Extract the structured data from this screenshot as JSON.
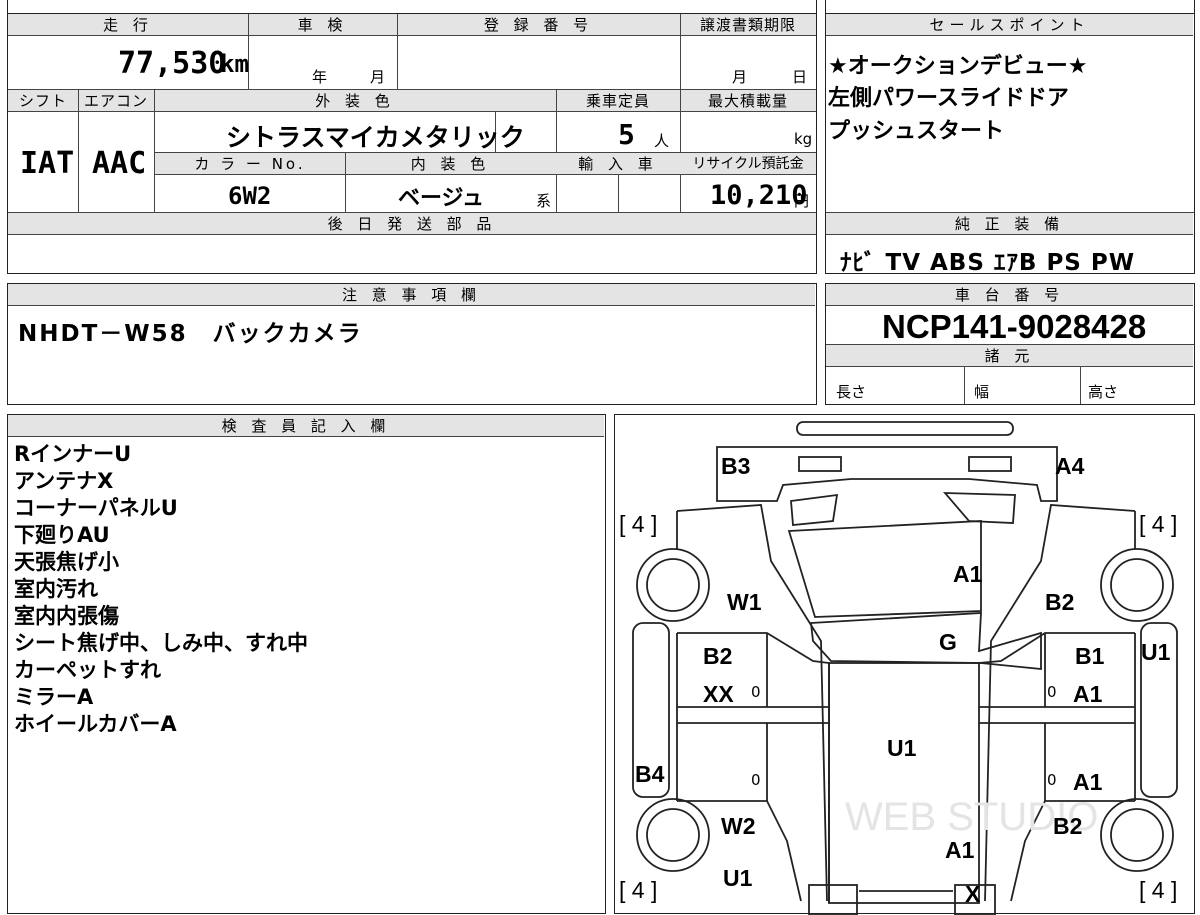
{
  "top_table": {
    "h_mileage": "走 行",
    "h_inspection": "車 検",
    "h_reg_number": "登 録 番 号",
    "h_transfer_deadline": "譲渡書類期限",
    "mileage": "77,530",
    "mileage_unit": "km",
    "insp_year": "年",
    "insp_month": "月",
    "tr_month": "月",
    "tr_day": "日",
    "h_shift": "シフト",
    "h_aircon": "エアコン",
    "h_ext_color": "外 装 色",
    "h_capacity": "乗車定員",
    "h_max_load": "最大積載量",
    "shift": "IAT",
    "aircon": "AAC",
    "ext_color": "シトラスマイカメタリック",
    "capacity": "5",
    "capacity_unit": "人",
    "load_unit": "kg",
    "h_color_no": "カ ラ ー No.",
    "h_int_color": "内 装 色",
    "h_import": "輸 入 車",
    "h_recycle": "リサイクル預託金",
    "color_no": "6W2",
    "int_color": "ベージュ",
    "int_color_suffix": "系",
    "recycle_fee": "10,210",
    "recycle_unit": "円",
    "h_later_parts": "後 日 発 送 部 品"
  },
  "sales_points": {
    "header": "セールスポイント",
    "lines": [
      "★オークションデビュー★",
      "左側パワースライドドア",
      "プッシュスタート"
    ]
  },
  "equipment": {
    "header": "純 正 装 備",
    "value": "ﾅﾋﾞ TV ABS ｴｱB PS PW"
  },
  "notes": {
    "header": "注 意 事 項 欄",
    "value": "NHDT－W58　バックカメラ"
  },
  "chassis": {
    "header": "車 台 番 号",
    "value": "NCP141-9028428",
    "spec_header": "諸 元",
    "length": "長さ",
    "width": "幅",
    "height": "高さ"
  },
  "inspector": {
    "header": "検 査 員 記 入 欄",
    "items": [
      "RインナーU",
      "アンテナX",
      "コーナーパネルU",
      "下廻りAU",
      "天張焦げ小",
      "室内汚れ",
      "室内内張傷",
      "シート焦げ中、しみ中、すれ中",
      "カーペットすれ",
      "ミラーA",
      "ホイールカバーA"
    ]
  },
  "diagram": {
    "labels": {
      "b3": "B3",
      "a4": "A4",
      "tire_fl": "[ 4 ]",
      "tire_fr": "[ 4 ]",
      "hood": "A1",
      "w1": "W1",
      "b2_front_right": "B2",
      "windshield": "G",
      "u1_right_side": "U1",
      "b2_left_door": "B2",
      "xx": "XX",
      "b1": "B1",
      "a1_right_door": "A1",
      "roof": "U1",
      "b4": "B4",
      "a1_right_rear": "A1",
      "w2": "W2",
      "b2_rear_right": "B2",
      "a1_rear": "A1",
      "tire_rl": "[ 4 ]",
      "u1_rear": "U1",
      "x_rear": "X",
      "tire_rr": "[ 4 ]",
      "z1": "0",
      "z2": "0",
      "z3": "0",
      "z4": "0"
    },
    "watermark": "WEB STUDIO"
  }
}
